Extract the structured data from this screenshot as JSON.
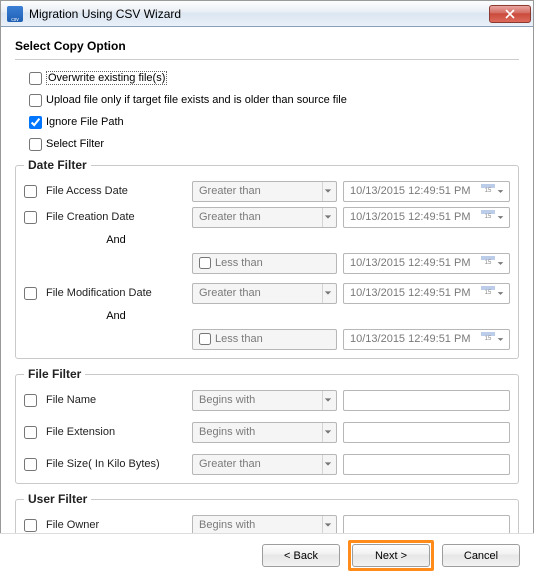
{
  "window": {
    "title": "Migration Using CSV Wizard"
  },
  "heading": "Select Copy Option",
  "options": {
    "overwrite": {
      "label": "Overwrite existing file(s)",
      "checked": false
    },
    "upload_if_older": {
      "label": "Upload file only if target file exists and is older than source file",
      "checked": false
    },
    "ignore_file_path": {
      "label": "Ignore File Path",
      "checked": true
    },
    "select_filter": {
      "label": "Select Filter",
      "checked": false
    }
  },
  "date_filter": {
    "legend": "Date Filter",
    "access": {
      "label": "File Access Date",
      "op": "Greater than",
      "value": "10/13/2015 12:49:51 PM"
    },
    "creation": {
      "label": "File Creation Date",
      "op1": "Greater than",
      "v1": "10/13/2015 12:49:51 PM",
      "and": "And",
      "op2": "Less than",
      "v2": "10/13/2015 12:49:51 PM"
    },
    "modification": {
      "label": "File Modification Date",
      "op1": "Greater than",
      "v1": "10/13/2015 12:49:51 PM",
      "and": "And",
      "op2": "Less than",
      "v2": "10/13/2015 12:49:51 PM"
    }
  },
  "file_filter": {
    "legend": "File Filter",
    "name": {
      "label": "File Name",
      "op": "Begins with",
      "value": ""
    },
    "extension": {
      "label": "File Extension",
      "op": "Begins with",
      "value": ""
    },
    "size": {
      "label": "File Size( In Kilo Bytes)",
      "op": "Greater than",
      "value": ""
    }
  },
  "user_filter": {
    "legend": "User Filter",
    "owner": {
      "label": "File Owner",
      "op": "Begins with",
      "value": ""
    }
  },
  "buttons": {
    "back": "< Back",
    "next": "Next >",
    "cancel": "Cancel"
  }
}
